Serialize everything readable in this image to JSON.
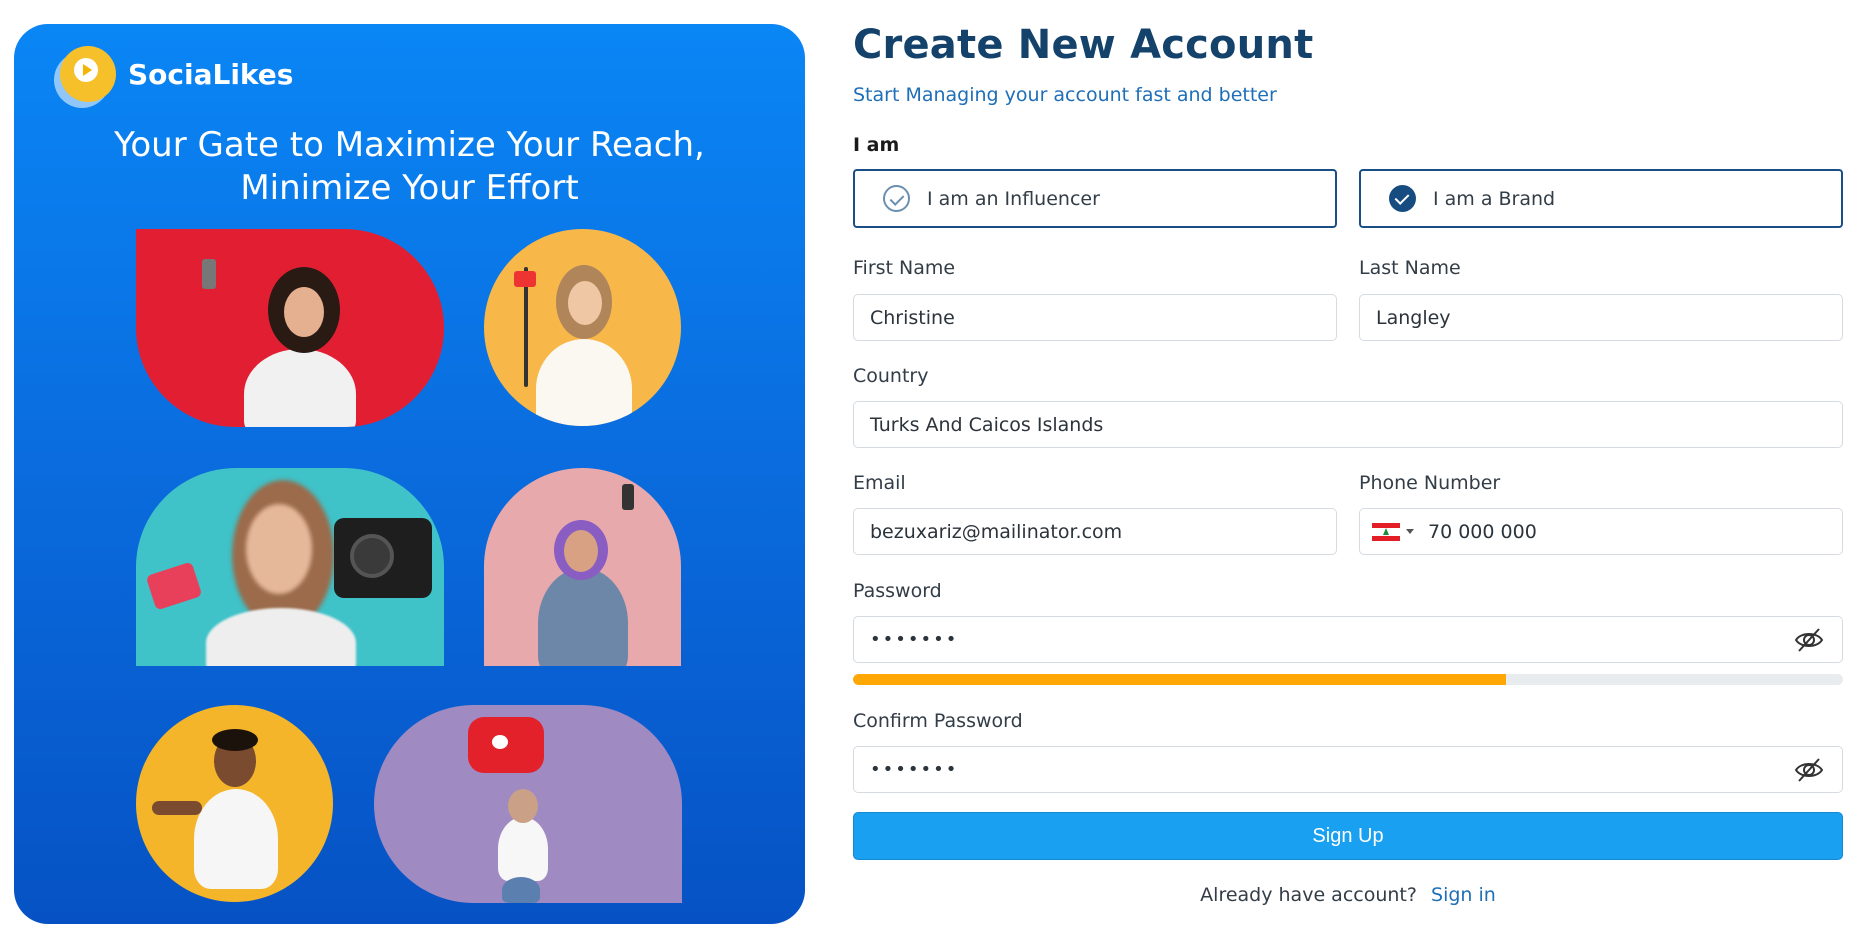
{
  "brand": {
    "name": "SociaLikes",
    "tagline_line1": "Your Gate to Maximize Your Reach,",
    "tagline_line2": "Minimize Your Effort"
  },
  "form": {
    "title": "Create New Account",
    "subtitle": "Start Managing your account fast and better",
    "role_label": "I am",
    "roles": [
      {
        "label": "I am an Influencer",
        "selected": false
      },
      {
        "label": "I am a Brand",
        "selected": true
      }
    ],
    "first_name": {
      "label": "First Name",
      "value": "Christine"
    },
    "last_name": {
      "label": "Last Name",
      "value": "Langley"
    },
    "country": {
      "label": "Country",
      "value": "Turks And Caicos Islands"
    },
    "email": {
      "label": "Email",
      "value": "bezuxariz@mailinator.com"
    },
    "phone": {
      "label": "Phone Number",
      "value": "70 000 000",
      "country_flag": "lebanon-flag-icon"
    },
    "password": {
      "label": "Password",
      "value": "•••••••",
      "strength": 0.66,
      "strength_color": "#ffa705"
    },
    "confirm_password": {
      "label": "Confirm Password",
      "value": "•••••••"
    },
    "submit_label": "Sign Up",
    "footer_text": "Already have account?",
    "footer_link": "Sign in"
  },
  "colors": {
    "panel_gradient_top": "#0a86f5",
    "panel_gradient_bottom": "#0652c4",
    "title": "#14426b",
    "accent": "#1e6fb8",
    "button": "#1aa0f0"
  },
  "icons": {
    "logo": "play-logo-icon",
    "toggle_password": "eye-slash-icon",
    "check": "check-circle-icon"
  }
}
